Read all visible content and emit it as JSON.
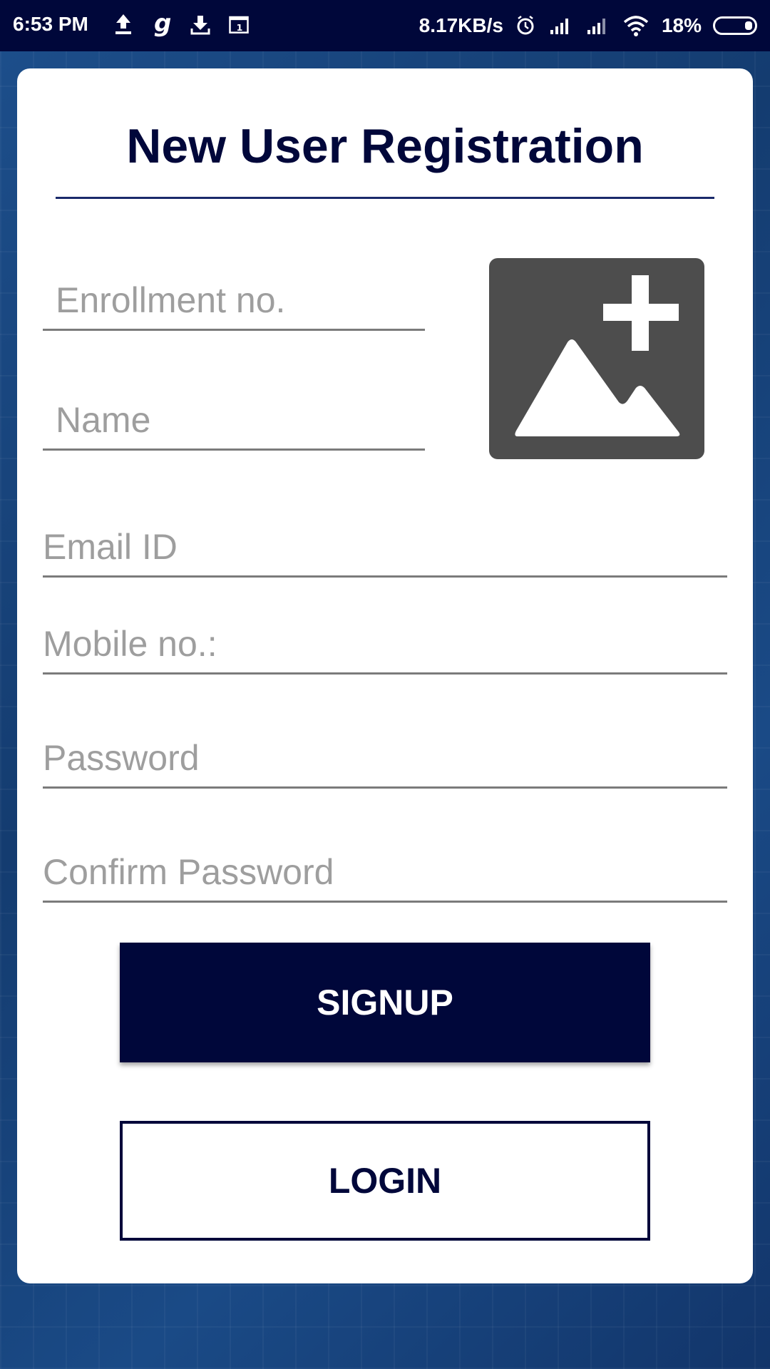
{
  "status_bar": {
    "time": "6:53 PM",
    "network_speed": "8.17KB/s",
    "battery_percent": "18%"
  },
  "form": {
    "title": "New User Registration",
    "enrollment_placeholder": "Enrollment no.",
    "name_placeholder": "Name",
    "email_placeholder": "Email ID",
    "mobile_placeholder": "Mobile no.:",
    "password_placeholder": "Password",
    "confirm_password_placeholder": "Confirm Password"
  },
  "buttons": {
    "signup_label": "SIGNUP",
    "login_label": "LOGIN"
  },
  "colors": {
    "primary": "#00073a",
    "card": "#ffffff",
    "photo_placeholder": "#4d4d4d"
  }
}
